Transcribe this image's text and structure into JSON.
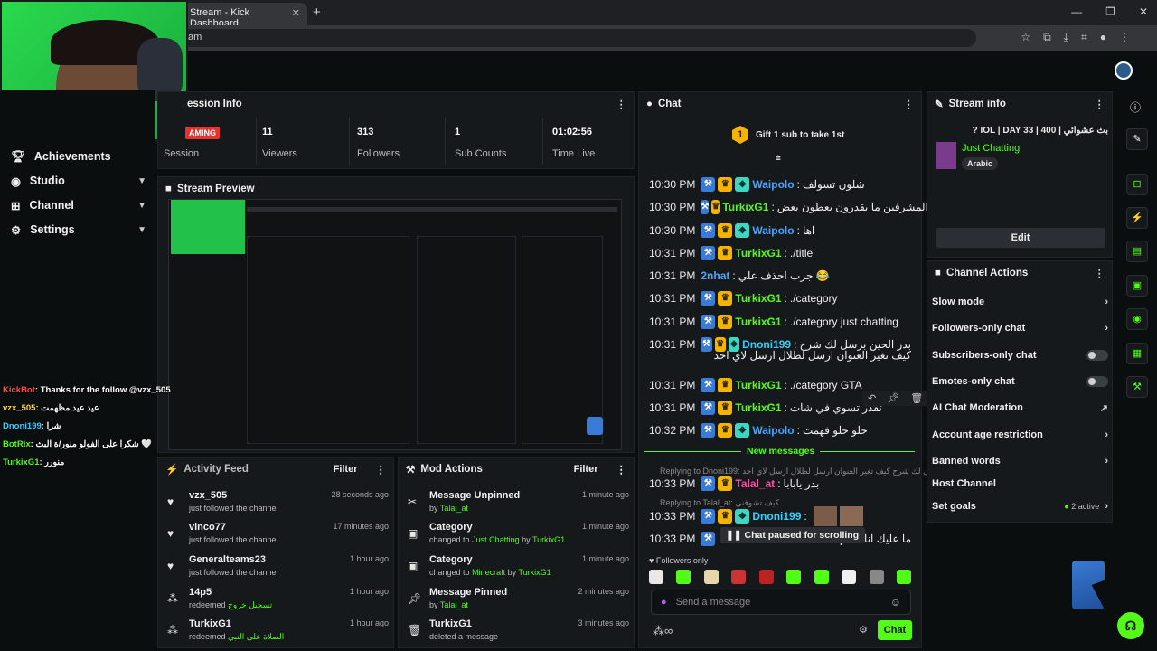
{
  "browser": {
    "tab_title": "Stream - Kick Dashboard",
    "url": "am"
  },
  "sidebar": {
    "items": [
      {
        "label": "Achievements"
      },
      {
        "label": "Studio"
      },
      {
        "label": "Channel"
      },
      {
        "label": "Settings"
      }
    ]
  },
  "session": {
    "title": "ession Info",
    "badge": "AMING",
    "session_label": "Session",
    "stats": [
      {
        "value": "11",
        "label": "Viewers"
      },
      {
        "value": "313",
        "label": "Followers"
      },
      {
        "value": "1",
        "label": "Sub Counts"
      },
      {
        "value": "01:02:56",
        "label": "Time Live"
      }
    ]
  },
  "preview": {
    "title": "Stream Preview"
  },
  "activity": {
    "title": "Activity Feed",
    "filter": "Filter",
    "items": [
      {
        "name": "vzx_505",
        "sub": "just followed the channel",
        "time": "28 seconds ago"
      },
      {
        "name": "vinco77",
        "sub": "just followed the channel",
        "time": "17 minutes ago"
      },
      {
        "name": "Generalteams23",
        "sub": "just followed the channel",
        "time": "1 hour ago"
      },
      {
        "name": "14p5",
        "sub": "redeemed",
        "extra": "تسجيل خروج",
        "time": "1 hour ago"
      },
      {
        "name": "TurkixG1",
        "sub": "redeemed",
        "extra": "الصلاة على النبي",
        "time": "1 hour ago"
      }
    ]
  },
  "mod": {
    "title": "Mod Actions",
    "filter": "Filter",
    "items": [
      {
        "name": "Message Unpinned",
        "by": "by",
        "who": "Talal_at",
        "time": "1 minute ago"
      },
      {
        "name": "Category",
        "by": "changed to",
        "who": "Just Chatting",
        "by2": "by",
        "who2": "TurkixG1",
        "time": "1 minute ago"
      },
      {
        "name": "Category",
        "by": "changed to",
        "who": "Minecraft",
        "by2": "by",
        "who2": "TurkixG1",
        "time": "1 minute ago"
      },
      {
        "name": "Message Pinned",
        "by": "by",
        "who": "Talal_at",
        "time": "2 minutes ago"
      },
      {
        "name": "TurkixG1",
        "by": "deleted a message",
        "time": "3 minutes ago"
      }
    ]
  },
  "chat": {
    "title": "Chat",
    "gift_num": "1",
    "gift_text": "Gift 1 sub to take 1st",
    "messages": [
      {
        "time": "10:30 PM",
        "user": "Waipolo",
        "color": "blue",
        "text": "شلون تسولف",
        "badges": "mcv"
      },
      {
        "time": "10:30 PM",
        "user": "TurkixG1",
        "color": "green",
        "text": "المشرفين ما يقدرون يعطون بعض",
        "badges": "mc"
      },
      {
        "time": "10:30 PM",
        "user": "Waipolo",
        "color": "blue",
        "text": "اها",
        "badges": "mcv"
      },
      {
        "time": "10:31 PM",
        "user": "TurkixG1",
        "color": "green",
        "text": "./title",
        "badges": "mc"
      },
      {
        "time": "10:31 PM",
        "user": "2nhat",
        "color": "blue",
        "text": "جرب احذف علي 😂",
        "badges": ""
      },
      {
        "time": "10:31 PM",
        "user": "TurkixG1",
        "color": "green",
        "text": "./category",
        "badges": "mc"
      },
      {
        "time": "10:31 PM",
        "user": "TurkixG1",
        "color": "green",
        "text": "./category just chatting",
        "badges": "mc"
      },
      {
        "time": "10:31 PM",
        "user": "Dnoni199",
        "color": "cyan",
        "text": "بدر الحين برسل لك شرح",
        "badges": "mcv"
      },
      {
        "time": "10:31 PM",
        "user": "TurkixG1",
        "color": "green",
        "text": "./category GTA",
        "badges": "mc"
      },
      {
        "time": "10:31 PM",
        "user": "TurkixG1",
        "color": "green",
        "text": "تقدر تسوي في شات",
        "badges": "mc"
      },
      {
        "time": "10:32 PM",
        "user": "Waipolo",
        "color": "blue",
        "text": "حلو حلو فهمت",
        "badges": "mcv"
      }
    ],
    "wrap_line": "كيف تغير العنوان ارسل لطلال ارسل لاي احد",
    "new_messages": "New messages",
    "reply1": "Replying to Dnoni199:",
    "reply1_text": "الحين برسل لك شرح كيف تغير العنوان ارسل لطلال ارسل لاي احد",
    "msg_after1": {
      "time": "10:33 PM",
      "user": "Talal_at",
      "text": "بدر يابابا"
    },
    "reply2": "Replying to Talal_at:",
    "reply2_text": "كيف تشوفني",
    "msg_after2": {
      "time": "10:33 PM",
      "user": "Dnoni199"
    },
    "msg_after3": {
      "time": "10:33 PM",
      "text": "ما عليك انا فاهم"
    },
    "paused": "Chat paused for scrolling",
    "followers_only": "Followers only",
    "placeholder": "Send a message",
    "send": "Chat"
  },
  "stream_info": {
    "title": "Stream info",
    "stream_title": "بث عشوائي | IOL | DAY 33 | 400 ?",
    "category": "Just Chatting",
    "language": "Arabic",
    "edit": "Edit"
  },
  "channel_actions": {
    "title": "Channel Actions",
    "items": [
      {
        "label": "Slow mode",
        "kind": "arrow"
      },
      {
        "label": "Followers-only chat",
        "kind": "arrow"
      },
      {
        "label": "Subscribers-only chat",
        "kind": "toggle"
      },
      {
        "label": "Emotes-only chat",
        "kind": "toggle"
      },
      {
        "label": "AI Chat Moderation",
        "kind": "ext"
      },
      {
        "label": "Account age restriction",
        "kind": "arrow"
      },
      {
        "label": "Banned words",
        "kind": "arrow"
      },
      {
        "label": "Host Channel",
        "kind": "none"
      },
      {
        "label": "Set goals",
        "kind": "arrow",
        "extra": "2 active"
      }
    ]
  },
  "overlay_chat": [
    {
      "user": "KickBot",
      "text": "Thanks for the follow @vzx_505",
      "color": "#ff4d4d"
    },
    {
      "user": "vzx_505",
      "text": "عيد عيد مظهمت",
      "color": "#ffd43b"
    },
    {
      "user": "Dnoni199",
      "text": "شرا",
      "color": "#35d0ff"
    },
    {
      "user": "BotRix",
      "text": "شكرا على الفولو منور/ة البث 🤍",
      "color": "#53fc18"
    },
    {
      "user": "TurkixG1",
      "text": "منورر",
      "color": "#53fc18"
    }
  ]
}
